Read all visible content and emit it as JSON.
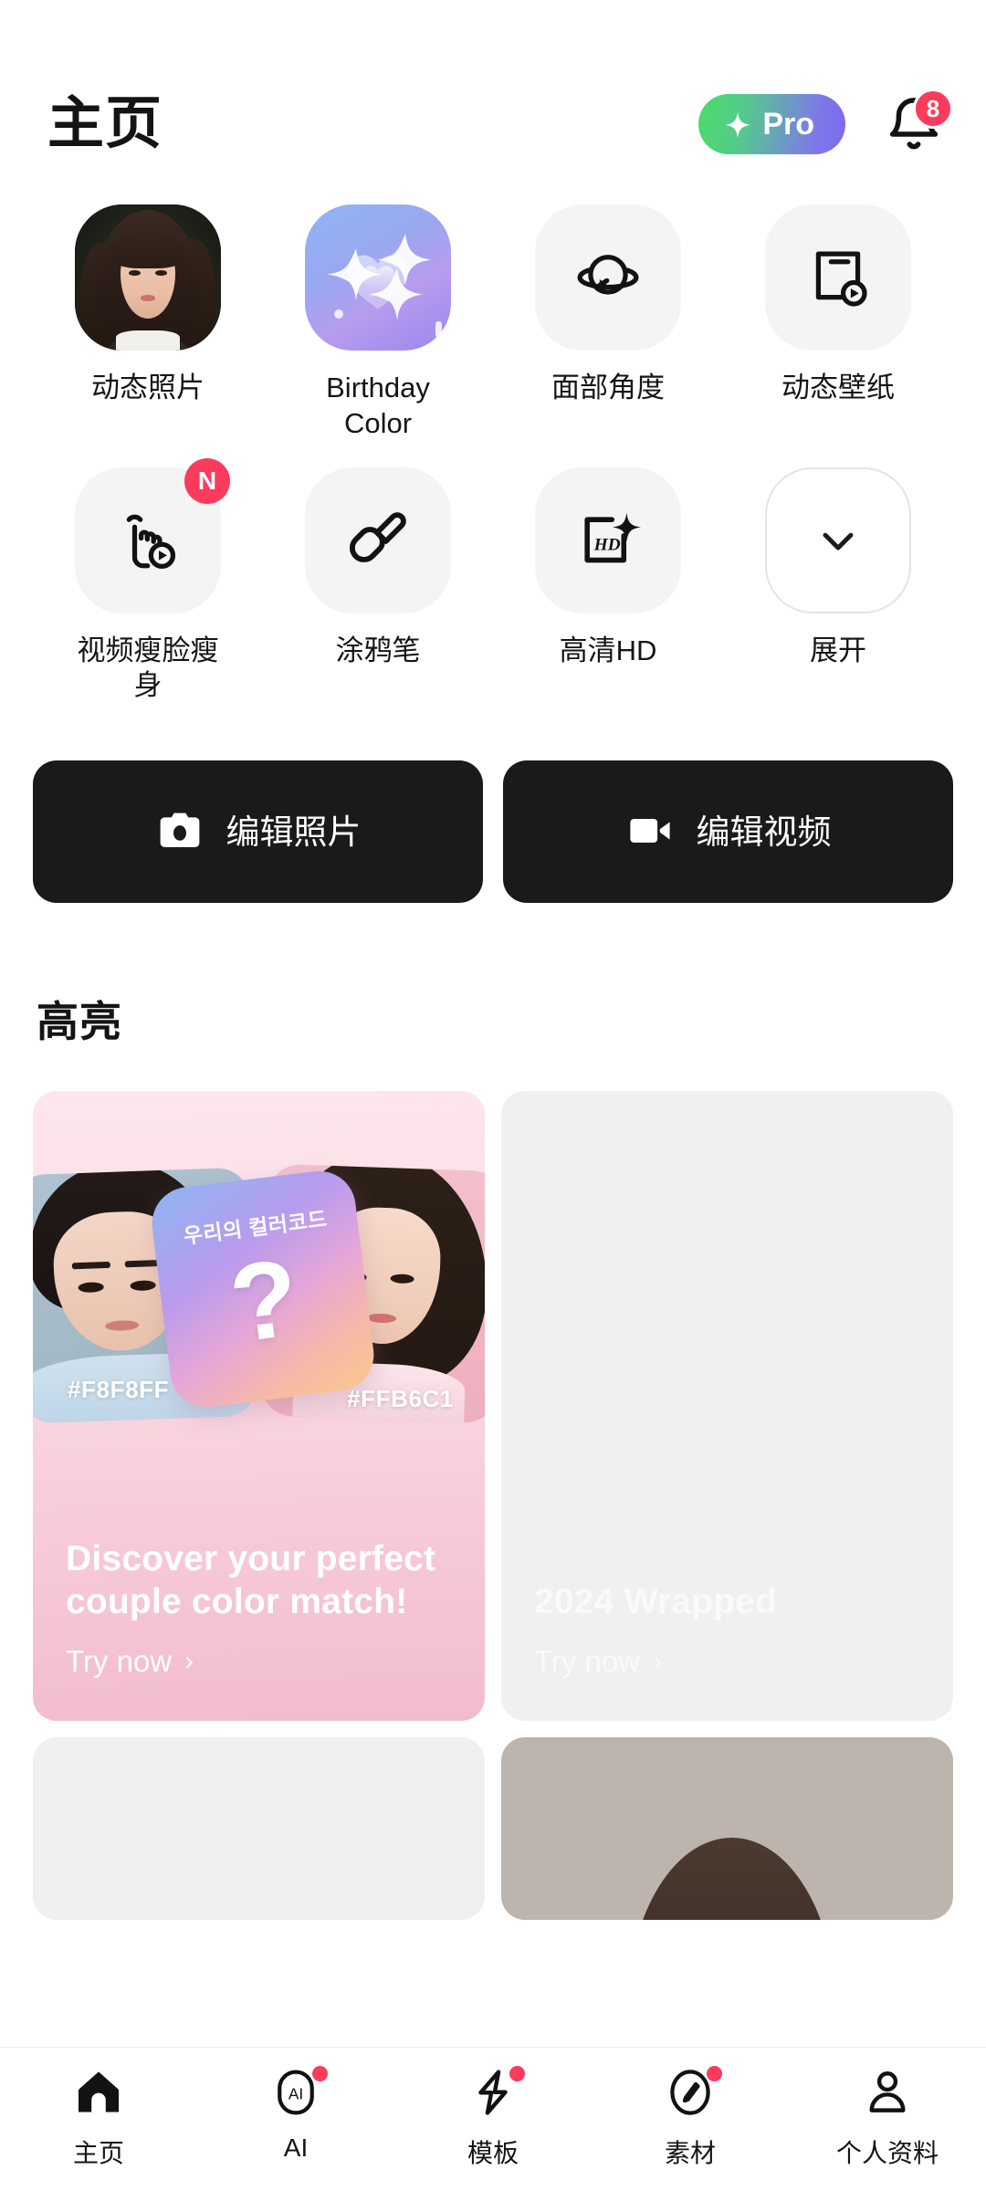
{
  "header": {
    "title": "主页",
    "pro_label": "Pro",
    "pro_icon": "sparkle-icon",
    "pro_gradient_from": "#4ADE68",
    "pro_gradient_to": "#7B68EE",
    "bell_icon": "bell-icon",
    "bell_badge_count": "8",
    "badge_color": "#FB3B5C"
  },
  "features": [
    {
      "label": "动态照片",
      "icon": "portrait-photo-icon",
      "badge": null,
      "style": "photo"
    },
    {
      "label": "Birthday Color",
      "icon": "heart-sparkle-icon",
      "badge": null,
      "style": "gradient"
    },
    {
      "label": "面部角度",
      "icon": "face-rotate-icon",
      "badge": null,
      "style": "plain"
    },
    {
      "label": "动态壁纸",
      "icon": "phone-play-icon",
      "badge": null,
      "style": "plain"
    },
    {
      "label": "视频瘦脸瘦身",
      "icon": "touch-gesture-play-icon",
      "badge": "N",
      "style": "plain"
    },
    {
      "label": "涂鸦笔",
      "icon": "paint-brush-icon",
      "badge": null,
      "style": "plain"
    },
    {
      "label": "高清HD",
      "icon": "hd-sparkle-icon",
      "badge": null,
      "style": "plain"
    },
    {
      "label": "展开",
      "icon": "chevron-down-icon",
      "badge": null,
      "style": "outlined"
    }
  ],
  "actions": {
    "edit_photo": {
      "label": "编辑照片",
      "icon": "camera-icon"
    },
    "edit_video": {
      "label": "编辑视频",
      "icon": "video-camera-icon"
    }
  },
  "highlights": {
    "section_title": "高亮",
    "cards": [
      {
        "headline": "Discover your perfect couple color match!",
        "cta": "Try now",
        "cta_chevron": "›",
        "mystery_caption": "우리의 컬러코드",
        "mystery_symbol": "?",
        "hex_left": "#F8F8FF",
        "hex_right": "#FFB6C1",
        "style": "couple"
      },
      {
        "headline": "2024 Wrapped",
        "cta": "Try now",
        "cta_chevron": "›",
        "style": "placeholder"
      }
    ]
  },
  "bottom_nav": [
    {
      "label": "主页",
      "icon": "home-icon",
      "active": true,
      "dot": false
    },
    {
      "label": "AI",
      "icon": "ai-icon",
      "active": false,
      "dot": true
    },
    {
      "label": "模板",
      "icon": "lightning-icon",
      "active": false,
      "dot": true
    },
    {
      "label": "素材",
      "icon": "compass-icon",
      "active": false,
      "dot": true
    },
    {
      "label": "个人资料",
      "icon": "person-icon",
      "active": false,
      "dot": false
    }
  ]
}
